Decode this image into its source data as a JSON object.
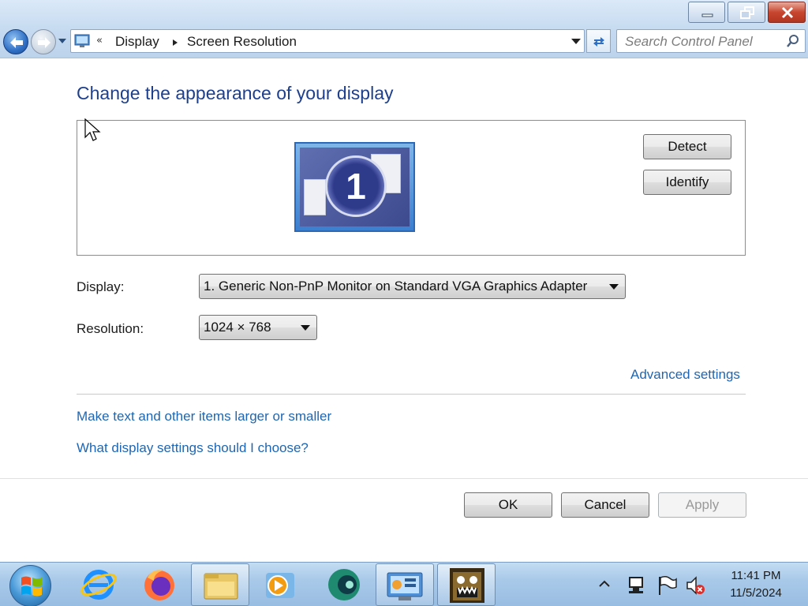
{
  "window": {
    "title_buttons": {
      "minimize": "minimize-icon",
      "maximize": "restore-icon",
      "close": "close-icon"
    }
  },
  "nav": {
    "breadcrumb_overflow": "«",
    "breadcrumbs": [
      "Display",
      "Screen Resolution"
    ],
    "search_placeholder": "Search Control Panel"
  },
  "content": {
    "heading": "Change the appearance of your display",
    "monitor_number": "1",
    "detect_label": "Detect",
    "identify_label": "Identify",
    "display_label": "Display:",
    "display_value": "1. Generic Non-PnP Monitor on Standard VGA Graphics Adapter",
    "resolution_label": "Resolution:",
    "resolution_value": "1024 × 768",
    "advanced_link": "Advanced settings",
    "text_size_link": "Make text and other items larger or smaller",
    "help_link": "What display settings should I choose?"
  },
  "footer": {
    "ok_label": "OK",
    "cancel_label": "Cancel",
    "apply_label": "Apply"
  },
  "taskbar": {
    "items": [
      "internet-explorer-icon",
      "firefox-icon",
      "file-explorer-icon",
      "media-player-icon",
      "app-icon",
      "control-panel-icon",
      "game-icon"
    ],
    "tray_icons": [
      "show-hidden-icons",
      "network-icon",
      "action-center-flag-icon",
      "volume-muted-icon"
    ],
    "time": "11:41 PM",
    "date": "11/5/2024"
  },
  "colors": {
    "link": "#1e66b3",
    "heading": "#1e3f8c",
    "titlebar": "#c5daf0",
    "taskbar": "#a9c9e9"
  }
}
